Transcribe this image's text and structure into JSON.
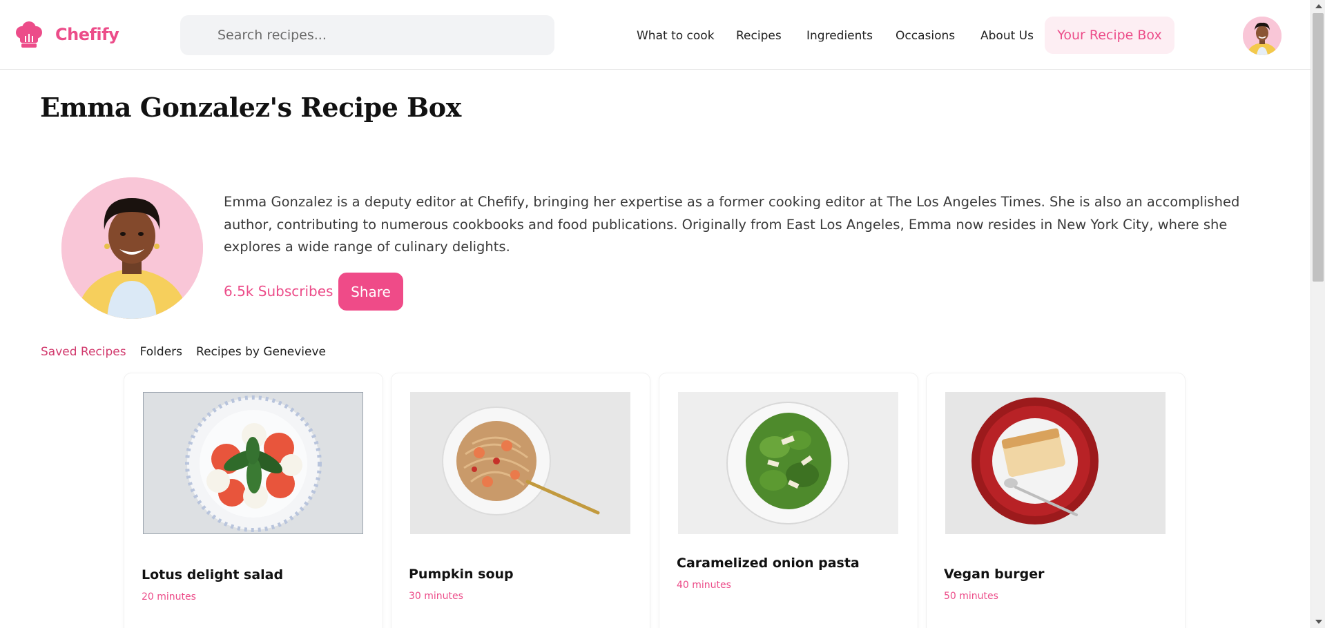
{
  "brand": {
    "name": "Chefify",
    "color": "#ec4c89"
  },
  "search": {
    "placeholder": "Search recipes..."
  },
  "nav": {
    "items": [
      {
        "label": "What to cook"
      },
      {
        "label": "Recipes"
      },
      {
        "label": "Ingredients"
      },
      {
        "label": "Occasions"
      },
      {
        "label": "About Us"
      }
    ],
    "recipe_box_label": "Your Recipe Box"
  },
  "page": {
    "title": "Emma Gonzalez's Recipe Box"
  },
  "profile": {
    "bio": "Emma Gonzalez is a deputy editor at Chefify, bringing her expertise as a former cooking editor at The Los Angeles Times. She is also an accomplished author, contributing to numerous cookbooks and food publications. Originally from East Los Angeles, Emma now resides in New York City, where she explores a wide range of culinary delights.",
    "subscribers": "6.5k Subscribes",
    "share_label": "Share"
  },
  "tabs": [
    {
      "label": "Saved Recipes",
      "active": true
    },
    {
      "label": "Folders",
      "active": false
    },
    {
      "label": "Recipes by Genevieve",
      "active": false
    }
  ],
  "recipes": [
    {
      "title": "Lotus delight salad",
      "time": "20 minutes"
    },
    {
      "title": "Pumpkin soup",
      "time": "30 minutes"
    },
    {
      "title": "Caramelized onion pasta",
      "time": "40 minutes"
    },
    {
      "title": "Vegan burger",
      "time": "50 minutes"
    }
  ]
}
